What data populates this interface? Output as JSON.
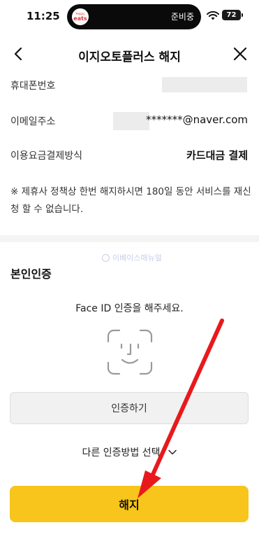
{
  "status_bar": {
    "time": "11:25",
    "island_badge_small": "Happy",
    "island_badge_main": "eats",
    "island_status": "준비중",
    "battery": "72",
    "icons": [
      "wifi-icon",
      "battery-icon"
    ]
  },
  "header": {
    "title": "이지오토플러스 해지",
    "icons": [
      "back-icon",
      "close-icon"
    ]
  },
  "info_rows": [
    {
      "label": "휴대폰번호",
      "value": ""
    },
    {
      "label": "이메일주소",
      "value": "*******@naver.com"
    },
    {
      "label": "이용요금결제방식",
      "value": "카드대금 결제"
    }
  ],
  "notice": "※ 제휴사 정책상 한번 해지하시면 180일 동안 서비스를 재신청 할 수 없습니다.",
  "watermark": "이베이스매뉴얼",
  "verification": {
    "title": "본인인증",
    "faceid_prompt": "Face ID 인증을 해주세요.",
    "auth_button": "인증하기",
    "other_method": "다른 인증방법 선택"
  },
  "cancel_button": "해지",
  "colors": {
    "primary_button": "#f7c51b",
    "annotation_arrow": "#e8191c"
  }
}
